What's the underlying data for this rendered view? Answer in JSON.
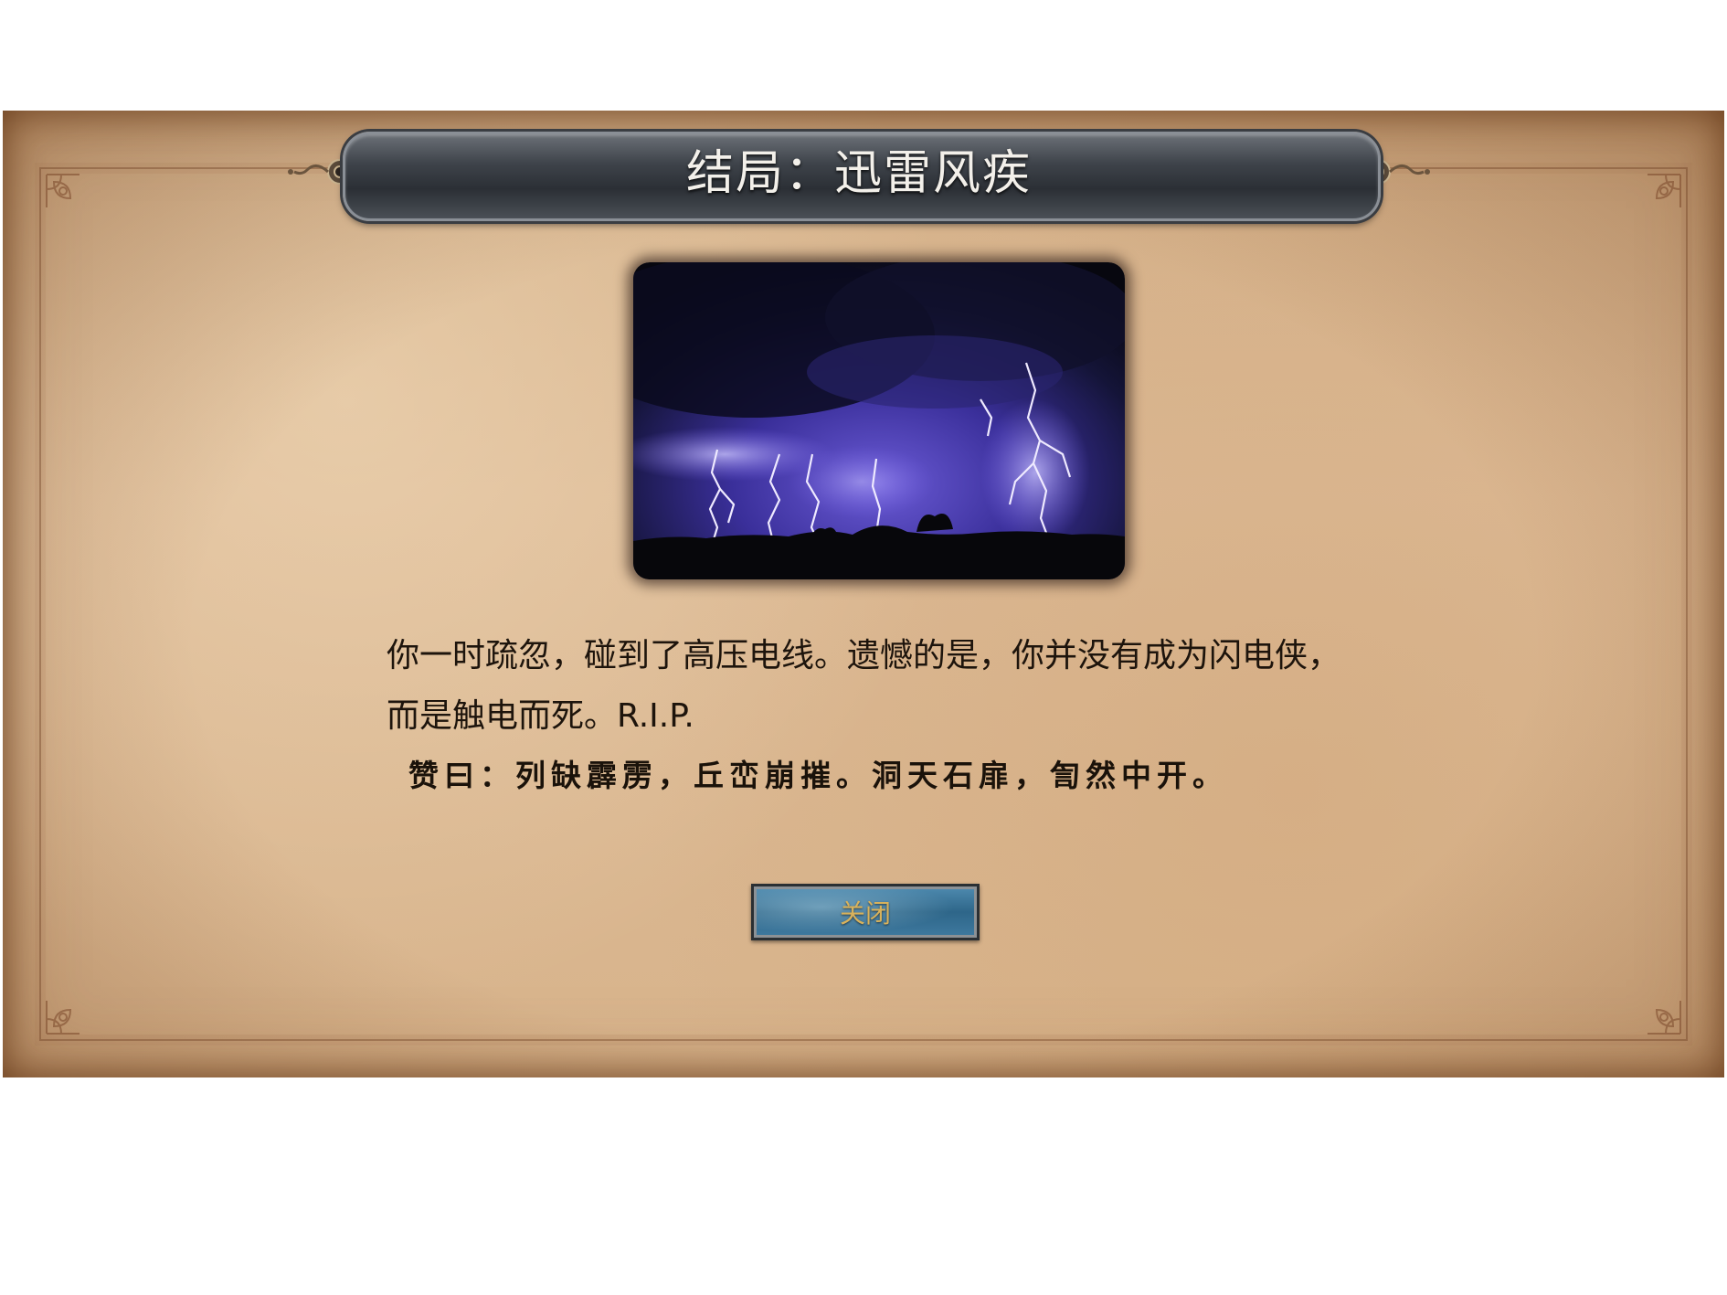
{
  "dialog": {
    "title": "结局：迅雷风疾",
    "illustration_icon": "lightning-storm-image",
    "body_line_1": "你一时疏忽，碰到了高压电线。遗憾的是，你并没有成为闪电侠，",
    "body_line_2": "而是触电而死。R.I.P.",
    "verse": "赞曰：列缺霹雳，丘峦崩摧。洞天石扉，訇然中开。",
    "close_label": "关闭"
  },
  "colors": {
    "parchment": "#d8b48c",
    "banner": "#3e434a",
    "title_text": "#f3f0ea",
    "body_text": "#1d140c",
    "button": "#2e6689",
    "button_text": "#d8b25c"
  }
}
